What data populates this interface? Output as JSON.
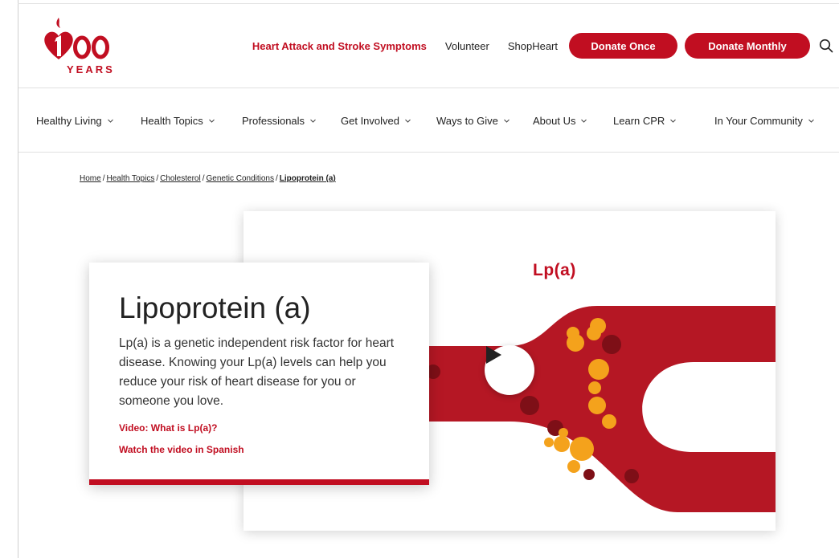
{
  "logo": {
    "number": "100",
    "word": "YEARS"
  },
  "utility_nav": {
    "symptoms_link": "Heart Attack and Stroke Symptoms",
    "volunteer_link": "Volunteer",
    "shop_link": "ShopHeart",
    "donate_once": "Donate Once",
    "donate_monthly": "Donate Monthly",
    "search_icon": "search-icon"
  },
  "main_nav": [
    {
      "label": "Healthy Living"
    },
    {
      "label": "Health Topics"
    },
    {
      "label": "Professionals"
    },
    {
      "label": "Get Involved"
    },
    {
      "label": "Ways to Give"
    },
    {
      "label": "About Us"
    },
    {
      "label": "Learn CPR"
    },
    {
      "label": "In Your Community"
    }
  ],
  "breadcrumb": [
    {
      "label": "Home"
    },
    {
      "label": "Health Topics"
    },
    {
      "label": "Cholesterol"
    },
    {
      "label": "Genetic Conditions"
    },
    {
      "label": "Lipoprotein (a)"
    }
  ],
  "breadcrumb_separator": "/",
  "hero": {
    "title": "Lipoprotein (a)",
    "description": "Lp(a) is a genetic independent risk factor for heart disease. Knowing your Lp(a) levels can help you reduce your risk of heart disease for you or someone you love.",
    "link_video": "Video: What is Lp(a)?",
    "link_spanish": "Watch the video in Spanish"
  },
  "video": {
    "title": "Lp(a)",
    "play_icon": "play-icon"
  },
  "colors": {
    "brand_red": "#c10e21",
    "artery_red": "#b51724",
    "particle_orange": "#f4a21c",
    "particle_dark": "#7e0f17"
  }
}
